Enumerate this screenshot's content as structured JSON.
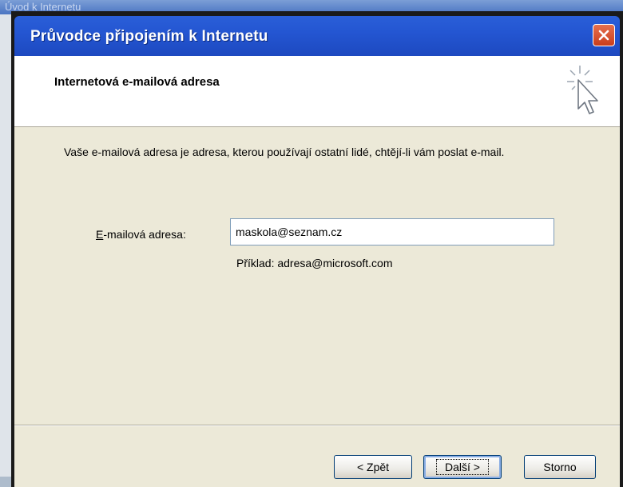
{
  "background_window": {
    "title": "Úvod k Internetu"
  },
  "dialog": {
    "title": "Průvodce připojením k Internetu",
    "header_title": "Internetová e-mailová adresa",
    "intro": "Vaše e-mailová adresa je adresa, kterou používají ostatní lidé, chtějí-li vám poslat e-mail.",
    "email_label_accel": "E",
    "email_label_rest": "-mailová adresa:",
    "email_value": "maskola@seznam.cz",
    "example": "Příklad: adresa@microsoft.com",
    "buttons": {
      "back": "< Zpět",
      "next": "Další >",
      "cancel": "Storno"
    }
  },
  "colors": {
    "titlebar": "#2456d2",
    "body": "#ece9d8",
    "close": "#c93d1b"
  }
}
